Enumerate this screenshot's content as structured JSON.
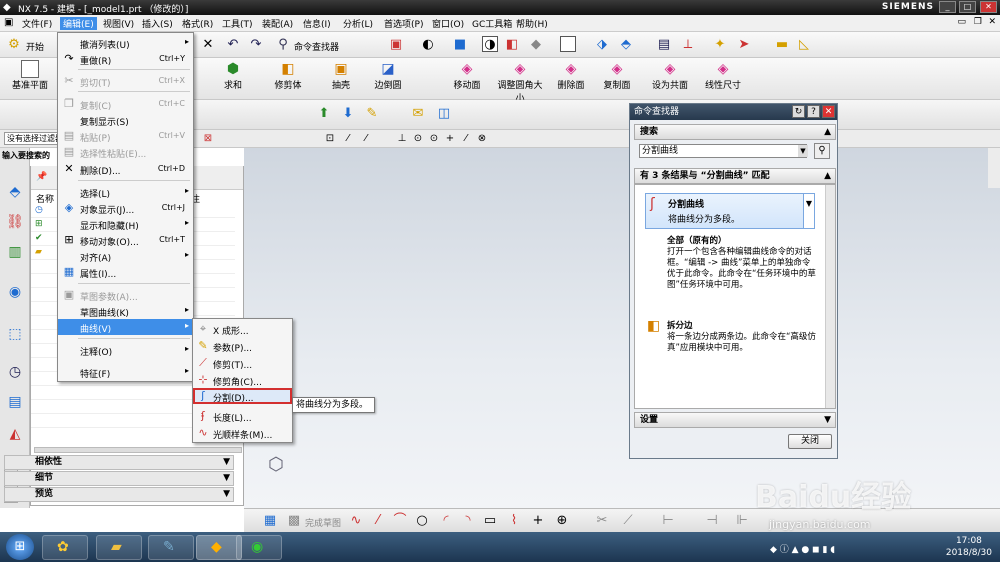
{
  "window": {
    "title": "NX 7.5 - 建模 - [_model1.prt （修改的）]",
    "brand": "SIEMENS",
    "ctrl": [
      "_",
      "□",
      "✕"
    ]
  },
  "menubar": [
    "文件(F)",
    "编辑(E)",
    "视图(V)",
    "插入(S)",
    "格式(R)",
    "工具(T)",
    "装配(A)",
    "信息(I)",
    "分析(L)",
    "首选项(P)",
    "窗口(O)",
    "GC工具箱",
    "帮助(H)"
  ],
  "toolbar1": {
    "start_label": "开始",
    "cmd_finder": "命令查找器"
  },
  "toolbar2": [
    "基准平面",
    "求和",
    "修剪体",
    "抽壳",
    "边倒圆",
    "移动面",
    "调整圆角大小",
    "删除面",
    "复制面",
    "设为共面",
    "线性尺寸"
  ],
  "toolbar3": {
    "selection": "没有选择过滤器"
  },
  "prompt": "输入要搜索的",
  "navigator": {
    "col_name": "名称",
    "col_extra": "注"
  },
  "edit_menu": [
    {
      "label": "撤消列表(U)",
      "shortcut": "",
      "arrow": "▸",
      "enabled": true
    },
    {
      "label": "重做(R)",
      "shortcut": "Ctrl+Y",
      "arrow": "",
      "enabled": true
    },
    {
      "label": "剪切(T)",
      "shortcut": "Ctrl+X",
      "arrow": "",
      "enabled": false
    },
    {
      "label": "复制(C)",
      "shortcut": "Ctrl+C",
      "arrow": "",
      "enabled": false
    },
    {
      "label": "复制显示(S)",
      "shortcut": "",
      "arrow": "",
      "enabled": true
    },
    {
      "label": "粘贴(P)",
      "shortcut": "Ctrl+V",
      "arrow": "",
      "enabled": false
    },
    {
      "label": "选择性粘贴(E)...",
      "shortcut": "",
      "arrow": "",
      "enabled": false
    },
    {
      "label": "删除(D)...",
      "shortcut": "Ctrl+D",
      "arrow": "",
      "enabled": true
    },
    {
      "label": "选择(L)",
      "shortcut": "",
      "arrow": "▸",
      "enabled": true
    },
    {
      "label": "对象显示(J)...",
      "shortcut": "Ctrl+J",
      "arrow": "",
      "enabled": true
    },
    {
      "label": "显示和隐藏(H)",
      "shortcut": "",
      "arrow": "▸",
      "enabled": true
    },
    {
      "label": "移动对象(O)...",
      "shortcut": "Ctrl+T",
      "arrow": "",
      "enabled": true
    },
    {
      "label": "对齐(A)",
      "shortcut": "",
      "arrow": "▸",
      "enabled": true
    },
    {
      "label": "属性(I)...",
      "shortcut": "",
      "arrow": "",
      "enabled": true
    },
    {
      "label": "草图参数(A)...",
      "shortcut": "",
      "arrow": "",
      "enabled": false
    },
    {
      "label": "草图曲线(K)",
      "shortcut": "",
      "arrow": "▸",
      "enabled": true
    },
    {
      "label": "曲线(V)",
      "shortcut": "",
      "arrow": "▸",
      "enabled": true
    },
    {
      "label": "注释(O)",
      "shortcut": "",
      "arrow": "▸",
      "enabled": true
    },
    {
      "label": "特征(F)",
      "shortcut": "",
      "arrow": "▸",
      "enabled": true
    }
  ],
  "curve_menu": [
    "X 成形...",
    "参数(P)...",
    "修剪(T)...",
    "修剪角(C)...",
    "分割(D)...",
    "长度(L)...",
    "光顺样条(M)..."
  ],
  "tooltip": "将曲线分为多段。",
  "cmd_finder": {
    "title": "命令查找器",
    "search_section": "搜索",
    "search_value": "分割曲线",
    "results_header": "有 3 条结果与 “分割曲线” 匹配",
    "results": [
      {
        "title": "分割曲线",
        "desc": "将曲线分为多段。"
      },
      {
        "title": "全部（原有的）",
        "desc": "打开一个包含各种编辑曲线命令的对话框。“编辑 -> 曲线”菜单上的单独命令优于此命令。此命令在“任务环境中的草图”任务环境中可用。"
      },
      {
        "title": "拆分边",
        "desc": "将一条边分成两条边。此命令在“高级仿真”应用模块中可用。"
      }
    ],
    "settings_section": "设置",
    "close_button": "关闭"
  },
  "panels": [
    "相依性",
    "细节",
    "预览"
  ],
  "bottom_toolbar": {
    "finish_sketch": "完成草图"
  },
  "taskbar": {
    "time": "17:08",
    "date": "2018/8/30"
  },
  "watermark": {
    "brand": "Baidu经验",
    "url": "jingyan.baidu.com"
  },
  "colors": {
    "highlight": "#3e8ee8",
    "titlebar": "#1a1a1a",
    "finder_title": "#2f4358",
    "selected_outline": "#d32f2f"
  }
}
